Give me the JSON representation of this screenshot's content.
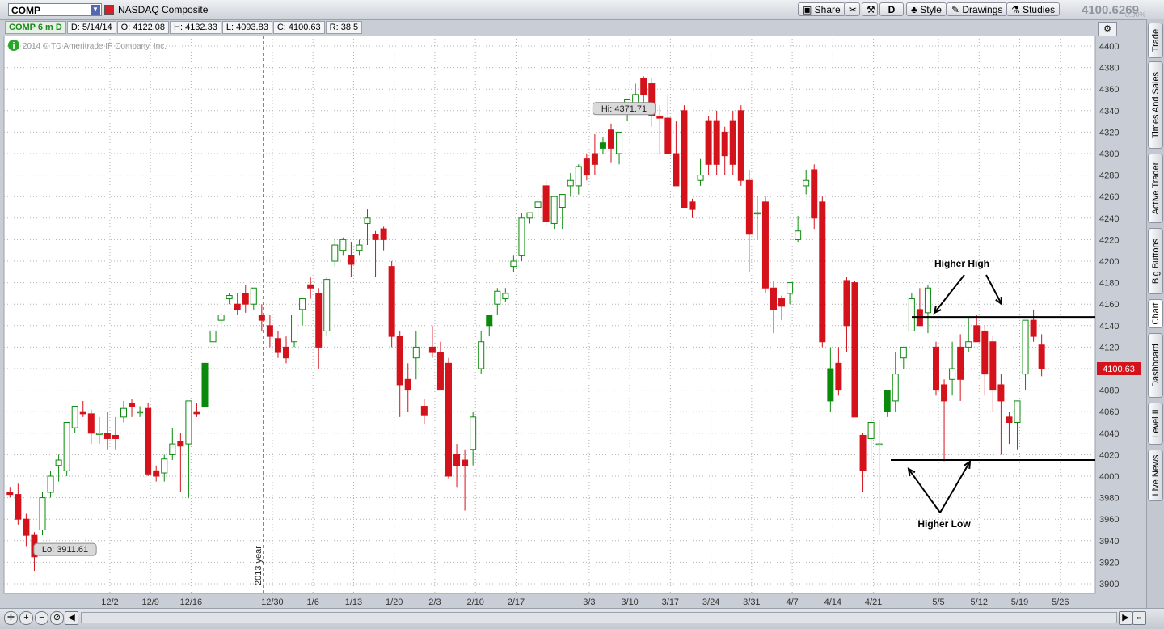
{
  "toolbar": {
    "symbol": "COMP",
    "company_name": "NASDAQ Composite",
    "share_label": "Share",
    "period_label": "D",
    "style_label": "Style",
    "drawings_label": "Drawings",
    "studies_label": "Studies",
    "last_price": "4100.6269",
    "change_pct": "0.00%"
  },
  "infobar": {
    "title": "COMP 6 m D",
    "date": "D: 5/14/14",
    "open": "O: 4122.08",
    "high": "H: 4132.33",
    "low": "L: 4093.83",
    "close": "C: 4100.63",
    "range": "R: 38.5"
  },
  "sidebar_tabs": [
    "Trade",
    "Times And Sales",
    "Active Trader",
    "Big Buttons",
    "Chart",
    "Dashboard",
    "Level II",
    "Live News"
  ],
  "colors": {
    "up": "#0a8a0a",
    "down": "#d4121b",
    "grid": "#b0b0b0",
    "price_tag": "#d4121b"
  },
  "chart_data": {
    "type": "candlestick",
    "copyright": "2014 © TD Ameritrade IP Company, Inc.",
    "ylim": [
      3890,
      4410
    ],
    "y_ticks": [
      3900,
      3920,
      3940,
      3960,
      3980,
      4000,
      4020,
      4040,
      4060,
      4080,
      4100,
      4120,
      4140,
      4160,
      4180,
      4200,
      4220,
      4240,
      4260,
      4280,
      4300,
      4320,
      4340,
      4360,
      4380,
      4400
    ],
    "x_ticks": [
      "12/2",
      "12/9",
      "12/16",
      "12/30",
      "1/6",
      "1/13",
      "1/20",
      "2/3",
      "2/10",
      "2/17",
      "3/3",
      "3/10",
      "3/17",
      "3/24",
      "3/31",
      "4/7",
      "4/14",
      "4/21",
      "5/5",
      "5/12",
      "5/19",
      "5/26"
    ],
    "x_tick_index": [
      12.3,
      17.3,
      22.3,
      32.3,
      37.3,
      42.3,
      47.3,
      52.3,
      57.3,
      62.3,
      71.3,
      76.3,
      81.3,
      86.3,
      91.3,
      96.3,
      101.3,
      106.3,
      114.3,
      119.3,
      124.3,
      129.3
    ],
    "year_marker": {
      "label": "2013 year",
      "index": 31.2
    },
    "hi_label": "Hi: 4371.71",
    "lo_label": "Lo: 3911.61",
    "hi_index": 74,
    "lo_index": 4,
    "last_price_tag": "4100.63",
    "annotations": {
      "higher_high": "Higher High",
      "higher_low": "Higher Low",
      "resistance": 4148,
      "support": 4015
    },
    "candles": [
      [
        3985,
        3990,
        3980,
        3983
      ],
      [
        3983,
        3993,
        3955,
        3960
      ],
      [
        3960,
        3965,
        3935,
        3945
      ],
      [
        3945,
        3948,
        3912,
        3925
      ],
      [
        3950,
        3985,
        3945,
        3980
      ],
      [
        3985,
        4005,
        3980,
        4000
      ],
      [
        4010,
        4020,
        3995,
        4015
      ],
      [
        4005,
        4045,
        4000,
        4050
      ],
      [
        4045,
        4065,
        4040,
        4065
      ],
      [
        4060,
        4070,
        4055,
        4058
      ],
      [
        4058,
        4062,
        4030,
        4040
      ],
      [
        4040,
        4055,
        4030,
        4040
      ],
      [
        4040,
        4060,
        4025,
        4035
      ],
      [
        4038,
        4055,
        4025,
        4035
      ],
      [
        4055,
        4070,
        4050,
        4063
      ],
      [
        4068,
        4072,
        4055,
        4065
      ],
      [
        4060,
        4065,
        4055,
        4060
      ],
      [
        4063,
        4068,
        4000,
        4002
      ],
      [
        4005,
        4010,
        3995,
        4000
      ],
      [
        4003,
        4020,
        3995,
        4016
      ],
      [
        4020,
        4045,
        4015,
        4030
      ],
      [
        4032,
        4040,
        3985,
        4028
      ],
      [
        4030,
        4070,
        3980,
        4070
      ],
      [
        4060,
        4068,
        4055,
        4058
      ],
      [
        4065,
        4110,
        4060,
        4105
      ],
      [
        4125,
        4135,
        4120,
        4135
      ],
      [
        4145,
        4152,
        4138,
        4150
      ],
      [
        4165,
        4170,
        4160,
        4168
      ],
      [
        4160,
        4170,
        4150,
        4155
      ],
      [
        4170,
        4178,
        4152,
        4160
      ],
      [
        4160,
        4175,
        4155,
        4175
      ],
      [
        4150,
        4160,
        4135,
        4145
      ],
      [
        4140,
        4150,
        4120,
        4130
      ],
      [
        4128,
        4135,
        4110,
        4115
      ],
      [
        4120,
        4130,
        4105,
        4110
      ],
      [
        4125,
        4145,
        4120,
        4150
      ],
      [
        4155,
        4165,
        4140,
        4165
      ],
      [
        4178,
        4185,
        4165,
        4175
      ],
      [
        4170,
        4175,
        4100,
        4120
      ],
      [
        4135,
        4185,
        4130,
        4183
      ],
      [
        4200,
        4220,
        4195,
        4215
      ],
      [
        4210,
        4222,
        4205,
        4220
      ],
      [
        4205,
        4218,
        4185,
        4197
      ],
      [
        4210,
        4220,
        4205,
        4215
      ],
      [
        4235,
        4248,
        4215,
        4240
      ],
      [
        4225,
        4228,
        4185,
        4220
      ],
      [
        4230,
        4232,
        4210,
        4220
      ],
      [
        4195,
        4200,
        4120,
        4130
      ],
      [
        4130,
        4135,
        4055,
        4085
      ],
      [
        4090,
        4105,
        4060,
        4080
      ],
      [
        4110,
        4135,
        4090,
        4120
      ],
      [
        4065,
        4072,
        4048,
        4057
      ],
      [
        4120,
        4140,
        4110,
        4115
      ],
      [
        4115,
        4125,
        4080,
        4080
      ],
      [
        4105,
        4110,
        3998,
        4000
      ],
      [
        4020,
        4030,
        3990,
        4010
      ],
      [
        4015,
        4025,
        3968,
        4010
      ],
      [
        4025,
        4060,
        4010,
        4055
      ],
      [
        4100,
        4135,
        4095,
        4125
      ],
      [
        4140,
        4150,
        4130,
        4150
      ],
      [
        4160,
        4175,
        4150,
        4172
      ],
      [
        4165,
        4175,
        4162,
        4170
      ],
      [
        4195,
        4205,
        4190,
        4200
      ],
      [
        4205,
        4245,
        4200,
        4240
      ],
      [
        4240,
        4245,
        4235,
        4245
      ],
      [
        4250,
        4260,
        4240,
        4255
      ],
      [
        4270,
        4275,
        4232,
        4237
      ],
      [
        4235,
        4245,
        4230,
        4260
      ],
      [
        4250,
        4260,
        4230,
        4262
      ],
      [
        4270,
        4282,
        4260,
        4275
      ],
      [
        4270,
        4290,
        4262,
        4288
      ],
      [
        4295,
        4300,
        4275,
        4280
      ],
      [
        4300,
        4318,
        4280,
        4290
      ],
      [
        4305,
        4315,
        4300,
        4310
      ],
      [
        4322,
        4328,
        4292,
        4305
      ],
      [
        4300,
        4320,
        4290,
        4320
      ],
      [
        4340,
        4350,
        4330,
        4350
      ],
      [
        4345,
        4365,
        4340,
        4355
      ],
      [
        4370,
        4372,
        4340,
        4355
      ],
      [
        4365,
        4370,
        4325,
        4335
      ],
      [
        4335,
        4345,
        4300,
        4333
      ],
      [
        4333,
        4355,
        4308,
        4300
      ],
      [
        4300,
        4330,
        4285,
        4270
      ],
      [
        4340,
        4345,
        4270,
        4250
      ],
      [
        4255,
        4258,
        4240,
        4248
      ],
      [
        4275,
        4295,
        4270,
        4280
      ],
      [
        4330,
        4335,
        4280,
        4290
      ],
      [
        4330,
        4340,
        4280,
        4290
      ],
      [
        4320,
        4325,
        4280,
        4298
      ],
      [
        4330,
        4340,
        4280,
        4290
      ],
      [
        4340,
        4345,
        4270,
        4275
      ],
      [
        4275,
        4285,
        4190,
        4225
      ],
      [
        4245,
        4260,
        4220,
        4245
      ],
      [
        4255,
        4260,
        4170,
        4175
      ],
      [
        4175,
        4182,
        4133,
        4155
      ],
      [
        4165,
        4168,
        4145,
        4158
      ],
      [
        4170,
        4180,
        4160,
        4180
      ],
      [
        4220,
        4242,
        4218,
        4228
      ],
      [
        4270,
        4285,
        4262,
        4275
      ],
      [
        4285,
        4290,
        4230,
        4240
      ],
      [
        4255,
        4260,
        4120,
        4125
      ],
      [
        4070,
        4120,
        4060,
        4100
      ],
      [
        4105,
        4120,
        4075,
        4080
      ],
      [
        4182,
        4185,
        4115,
        4140
      ],
      [
        4180,
        4182,
        4100,
        4055
      ],
      [
        4038,
        4040,
        3985,
        4005
      ],
      [
        4035,
        4055,
        4015,
        4050
      ],
      [
        4030,
        4052,
        3945,
        4030
      ],
      [
        4060,
        4080,
        4055,
        4080
      ],
      [
        4070,
        4115,
        4060,
        4095
      ],
      [
        4110,
        4120,
        4100,
        4120
      ],
      [
        4135,
        4170,
        4135,
        4165
      ],
      [
        4155,
        4175,
        4150,
        4140
      ],
      [
        4152,
        4178,
        4133,
        4175
      ],
      [
        4120,
        4125,
        4075,
        4080
      ],
      [
        4085,
        4090,
        4014,
        4070
      ],
      [
        4090,
        4125,
        4075,
        4100
      ],
      [
        4120,
        4132,
        4070,
        4090
      ],
      [
        4120,
        4148,
        4115,
        4125
      ],
      [
        4140,
        4150,
        4125,
        4125
      ],
      [
        4135,
        4140,
        4075,
        4095
      ],
      [
        4125,
        4130,
        4060,
        4080
      ],
      [
        4085,
        4095,
        4020,
        4070
      ],
      [
        4055,
        4060,
        4030,
        4050
      ],
      [
        4050,
        4065,
        4025,
        4070
      ],
      [
        4095,
        4145,
        4080,
        4145
      ],
      [
        4145,
        4155,
        4125,
        4130
      ],
      [
        4122,
        4132,
        4093,
        4100
      ]
    ]
  }
}
